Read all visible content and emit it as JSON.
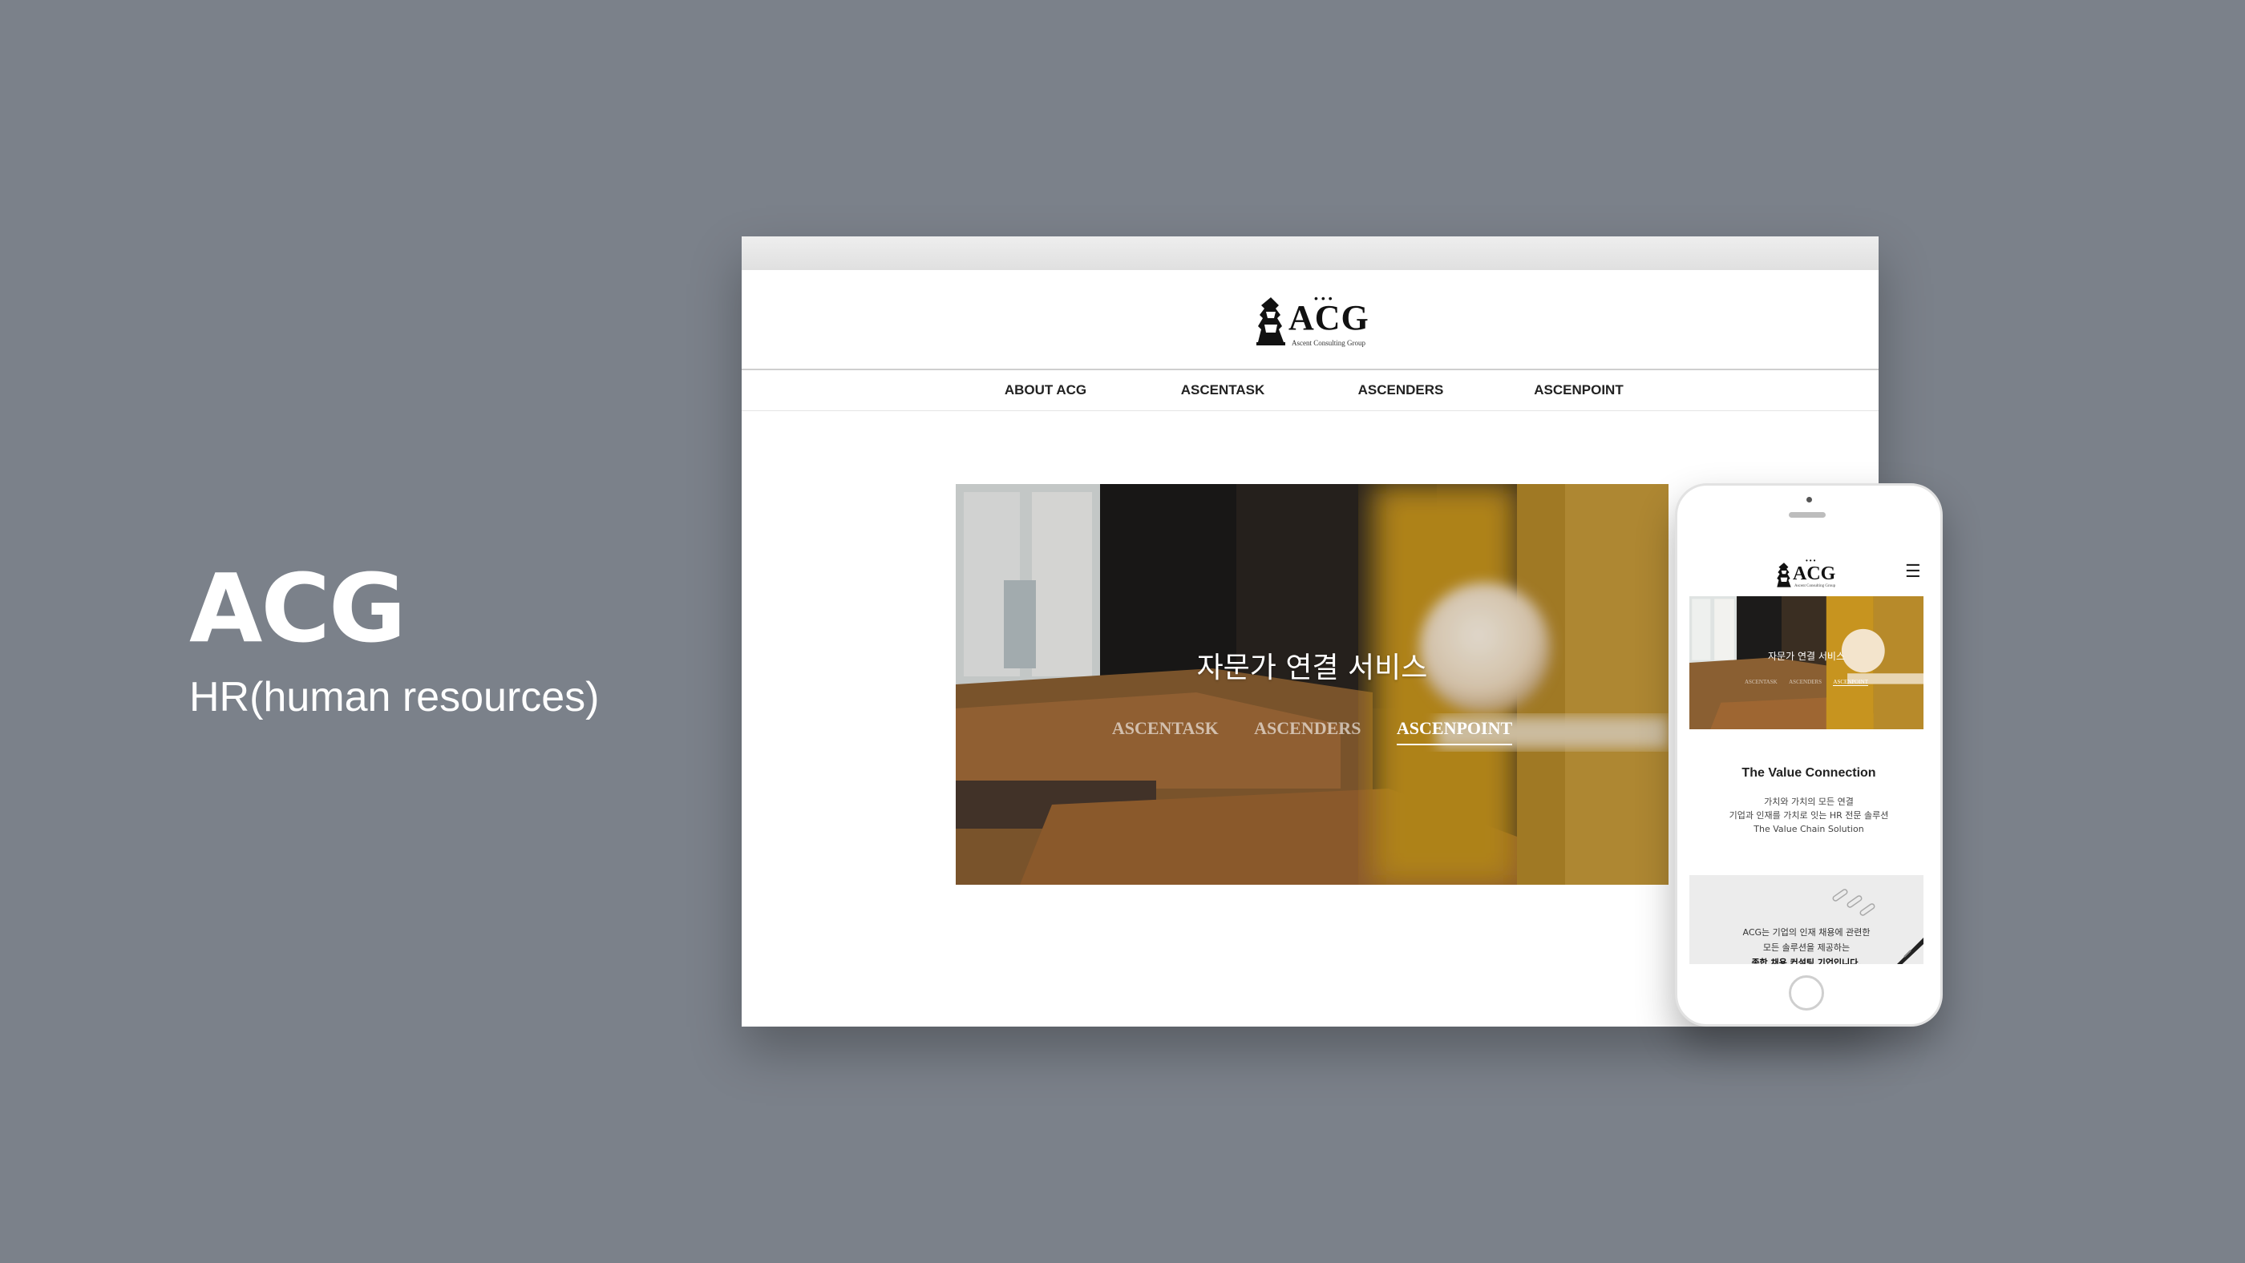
{
  "caption": {
    "title": "ACG",
    "subtitle": "HR(human resources)"
  },
  "desktop": {
    "logo": {
      "text": "ACG",
      "tagline": "Ascent Consulting Group"
    },
    "nav": [
      "ABOUT ACG",
      "ASCENTASK",
      "ASCENDERS",
      "ASCENPOINT"
    ],
    "hero": {
      "title": "자문가 연결 서비스",
      "links": [
        "ASCENTASK",
        "ASCENDERS",
        "ASCENPOINT"
      ],
      "active_link": "ASCENPOINT"
    }
  },
  "mobile": {
    "logo": {
      "text": "ACG",
      "tagline": "Ascent Consulting Group"
    },
    "menu_icon": "hamburger-menu-icon",
    "hero": {
      "title": "자문가 연결 서비스",
      "links": [
        "ASCENTASK",
        "ASCENDERS",
        "ASCENPOINT"
      ]
    },
    "value_section": {
      "title": "The Value Connection",
      "lines": [
        "가치와 가치의 모든 연결",
        "기업과 인재를 가치로 잇는 HR 전문 솔루션",
        "The Value Chain Solution"
      ]
    },
    "card": {
      "lines": [
        "ACG는 기업의 인재 채용에 관련한",
        "모든 솔루션을 제공하는",
        "종합 채용 컨설팅 기업입니다."
      ]
    }
  },
  "colors": {
    "background": "#7b818a",
    "white": "#ffffff",
    "hero_mustard": "#c7941f",
    "sofa_brown": "#8a5f32"
  }
}
